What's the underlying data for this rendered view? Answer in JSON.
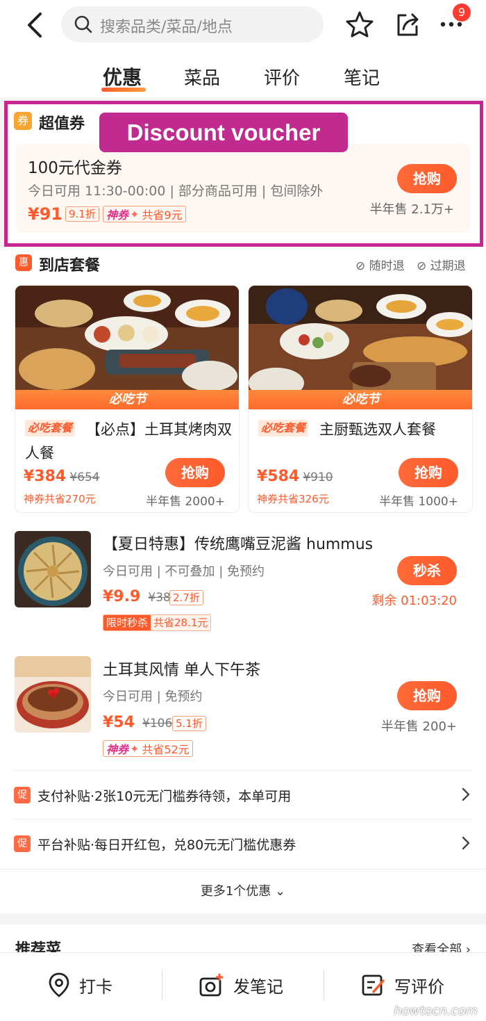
{
  "header": {
    "search_placeholder": "搜索品类/菜品/地点",
    "notification_count": "9"
  },
  "tabs": [
    "优惠",
    "菜品",
    "评价",
    "笔记"
  ],
  "overlay_label": "Discount voucher",
  "voucher_section": {
    "icon_char": "券",
    "title": "超值券",
    "voucher": {
      "title": "100元代金券",
      "subtitle": "今日可用 11:30-00:00 | 部分商品可用 | 包间除外",
      "price": "¥91",
      "discount": "9.1折",
      "shen_label": "神券",
      "savings": "共省9元",
      "button": "抢购",
      "sold": "半年售 2.1万+"
    }
  },
  "package_section": {
    "icon_char": "惠",
    "title": "到店套餐",
    "assurances": [
      "随时退",
      "过期退"
    ],
    "packages": [
      {
        "band": "必吃节",
        "badge": "必吃套餐",
        "title": "【必点】土耳其烤肉双人餐",
        "price": "¥384",
        "old_price": "¥654",
        "savings": "神券共省270元",
        "sold": "半年售 2000+",
        "button": "抢购"
      },
      {
        "band": "必吃节",
        "badge": "必吃套餐",
        "title": "主厨甄选双人套餐",
        "price": "¥584",
        "old_price": "¥910",
        "savings": "神券共省326元",
        "sold": "半年售 1000+",
        "button": "抢购"
      }
    ]
  },
  "deals": [
    {
      "title": "【夏日特惠】传统鹰嘴豆泥酱 hummus",
      "subtitle": "今日可用 | 不可叠加 | 免预约",
      "price": "¥9.9",
      "old_price": "¥38",
      "discount": "2.7折",
      "flash_label": "限时秒杀",
      "savings": "共省28.1元",
      "button": "秒杀",
      "countdown": "剩余 01:03:20"
    },
    {
      "title": "土耳其风情 单人下午茶",
      "subtitle": "今日可用 | 免预约",
      "price": "¥54",
      "old_price": "¥106",
      "discount": "5.1折",
      "shen_label": "神券",
      "savings": "共省52元",
      "button": "抢购",
      "sold": "半年售 200+"
    }
  ],
  "promos": [
    {
      "icon_char": "促",
      "text": "支付补贴·2张10元无门槛券待领，本单可用"
    },
    {
      "icon_char": "促",
      "text": "平台补贴·每日开红包，兑80元无门槛优惠券"
    }
  ],
  "more_offers": "更多1个优惠",
  "recommended": {
    "title": "推荐菜",
    "view_all": "查看全部"
  },
  "bottom_bar": [
    "打卡",
    "发笔记",
    "写评价"
  ],
  "watermark": "howtocn.com",
  "colors": {
    "accent": "#ff5a2c",
    "highlight_border": "#c5268f"
  }
}
